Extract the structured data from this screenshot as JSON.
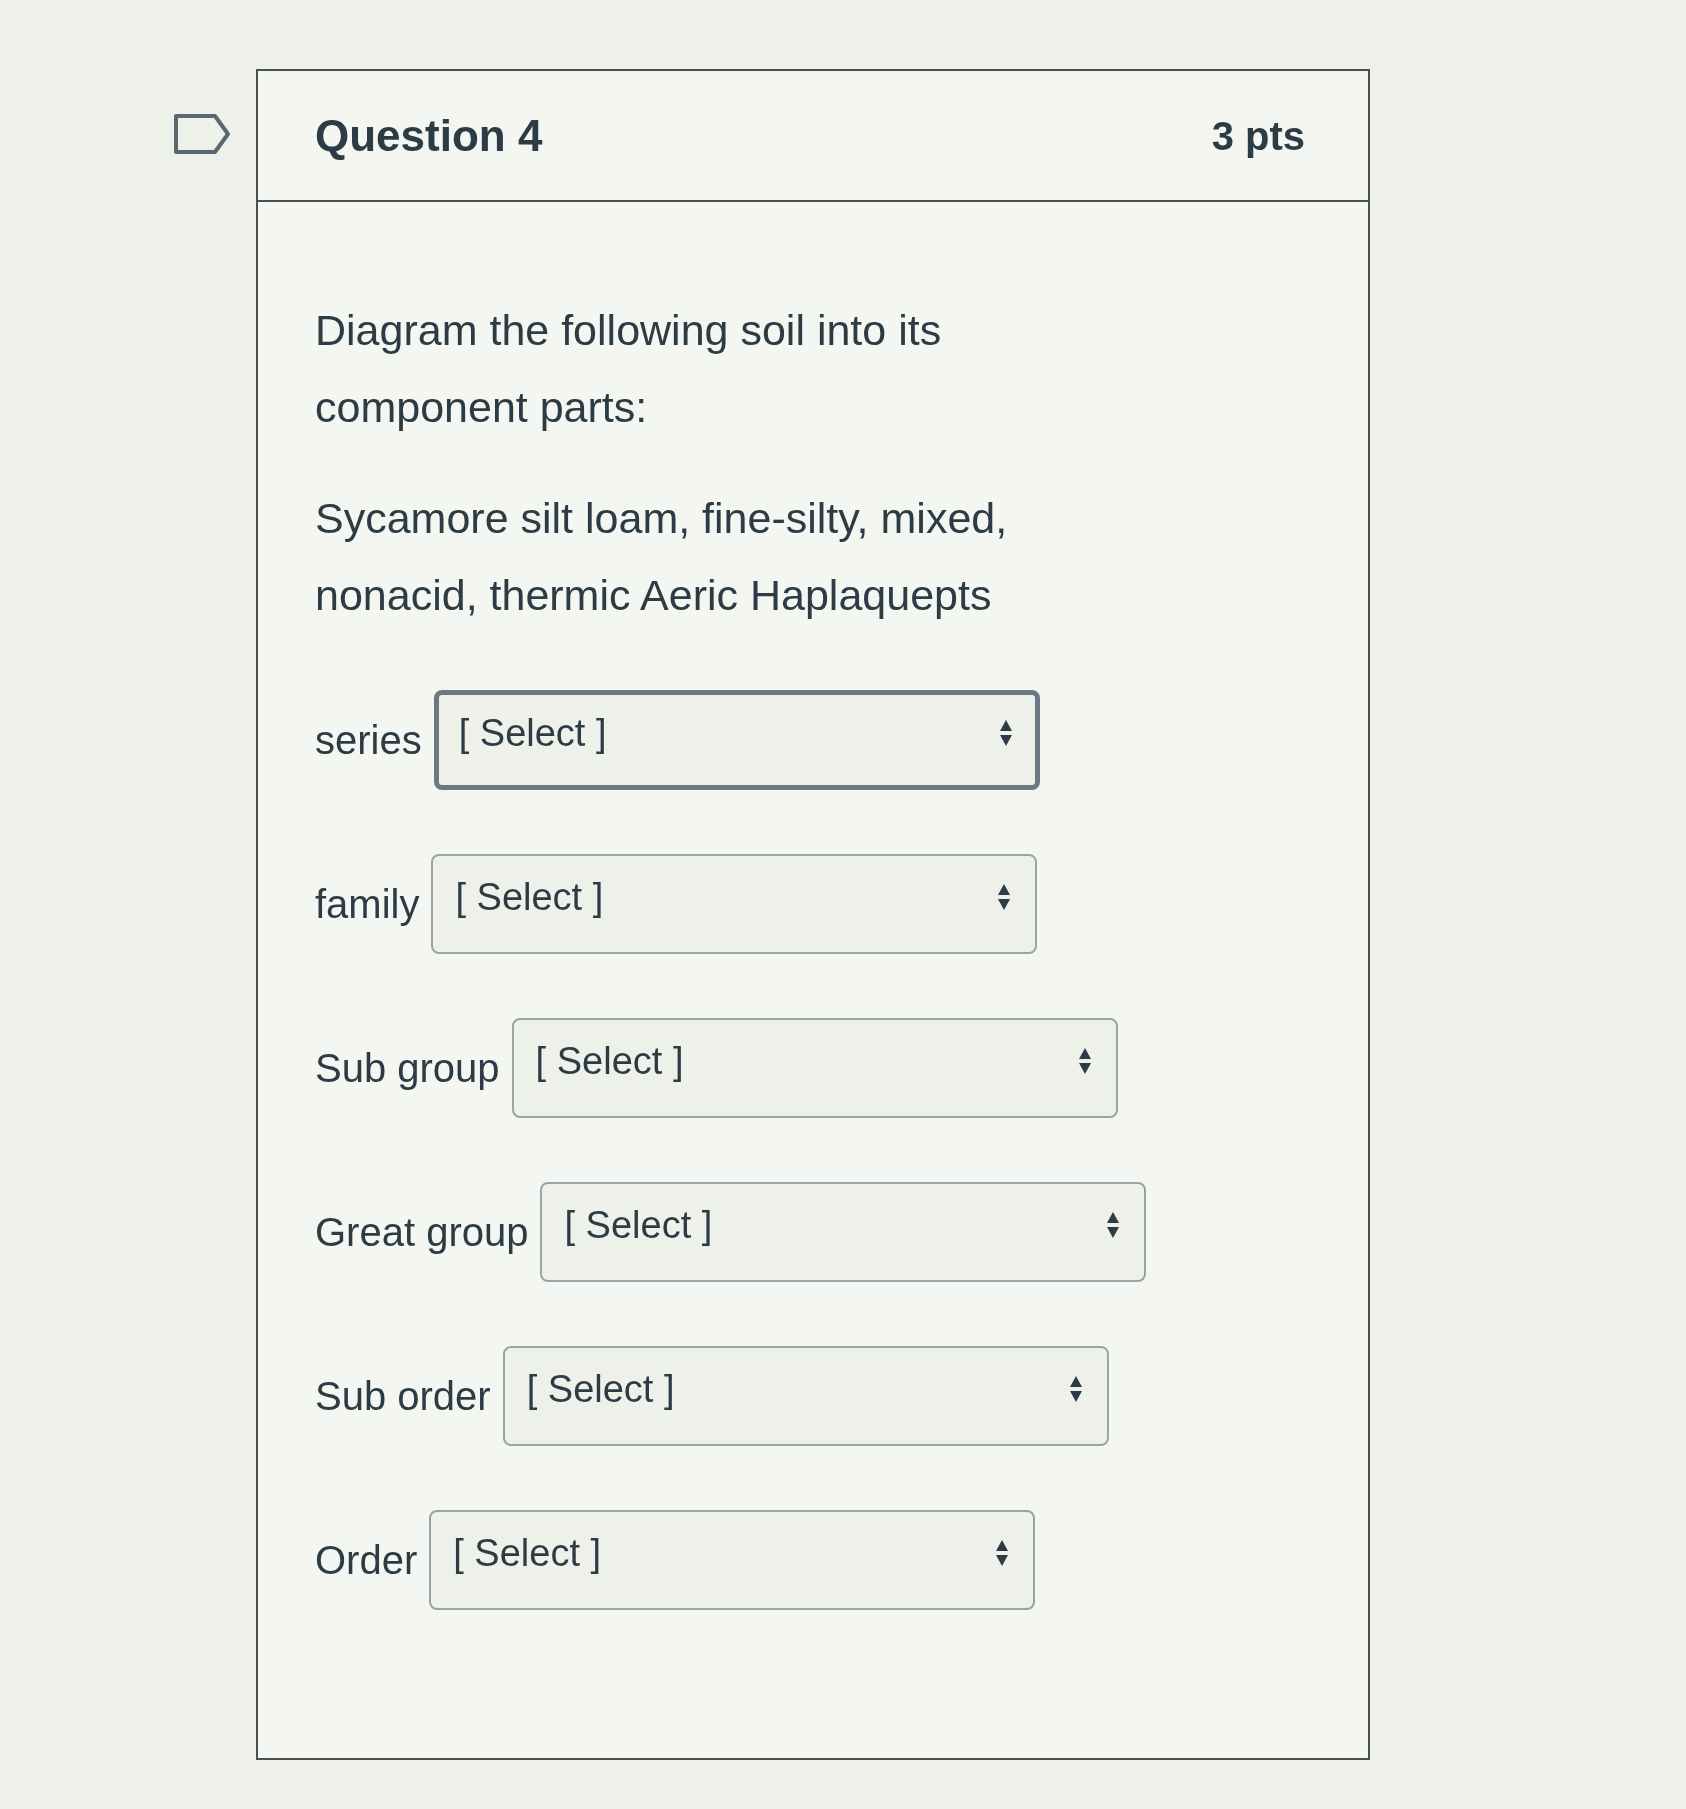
{
  "question": {
    "flagged": false,
    "title": "Question 4",
    "points": "3 pts"
  },
  "paragraphs": [
    "Diagram the following soil into its component parts:",
    "Sycamore silt loam, fine-silty, mixed, nonacid, thermic Aeric Haplaquepts"
  ],
  "dropdowns": [
    {
      "label": "series",
      "placeholder": "[ Select ]",
      "focused": true
    },
    {
      "label": "family",
      "placeholder": "[ Select ]",
      "focused": false
    },
    {
      "label": "Sub group",
      "placeholder": "[ Select ]",
      "focused": false
    },
    {
      "label": "Great group",
      "placeholder": "[ Select ]",
      "focused": false
    },
    {
      "label": "Sub order",
      "placeholder": "[ Select ]",
      "focused": false
    },
    {
      "label": "Order",
      "placeholder": "[ Select ]",
      "focused": false
    }
  ]
}
